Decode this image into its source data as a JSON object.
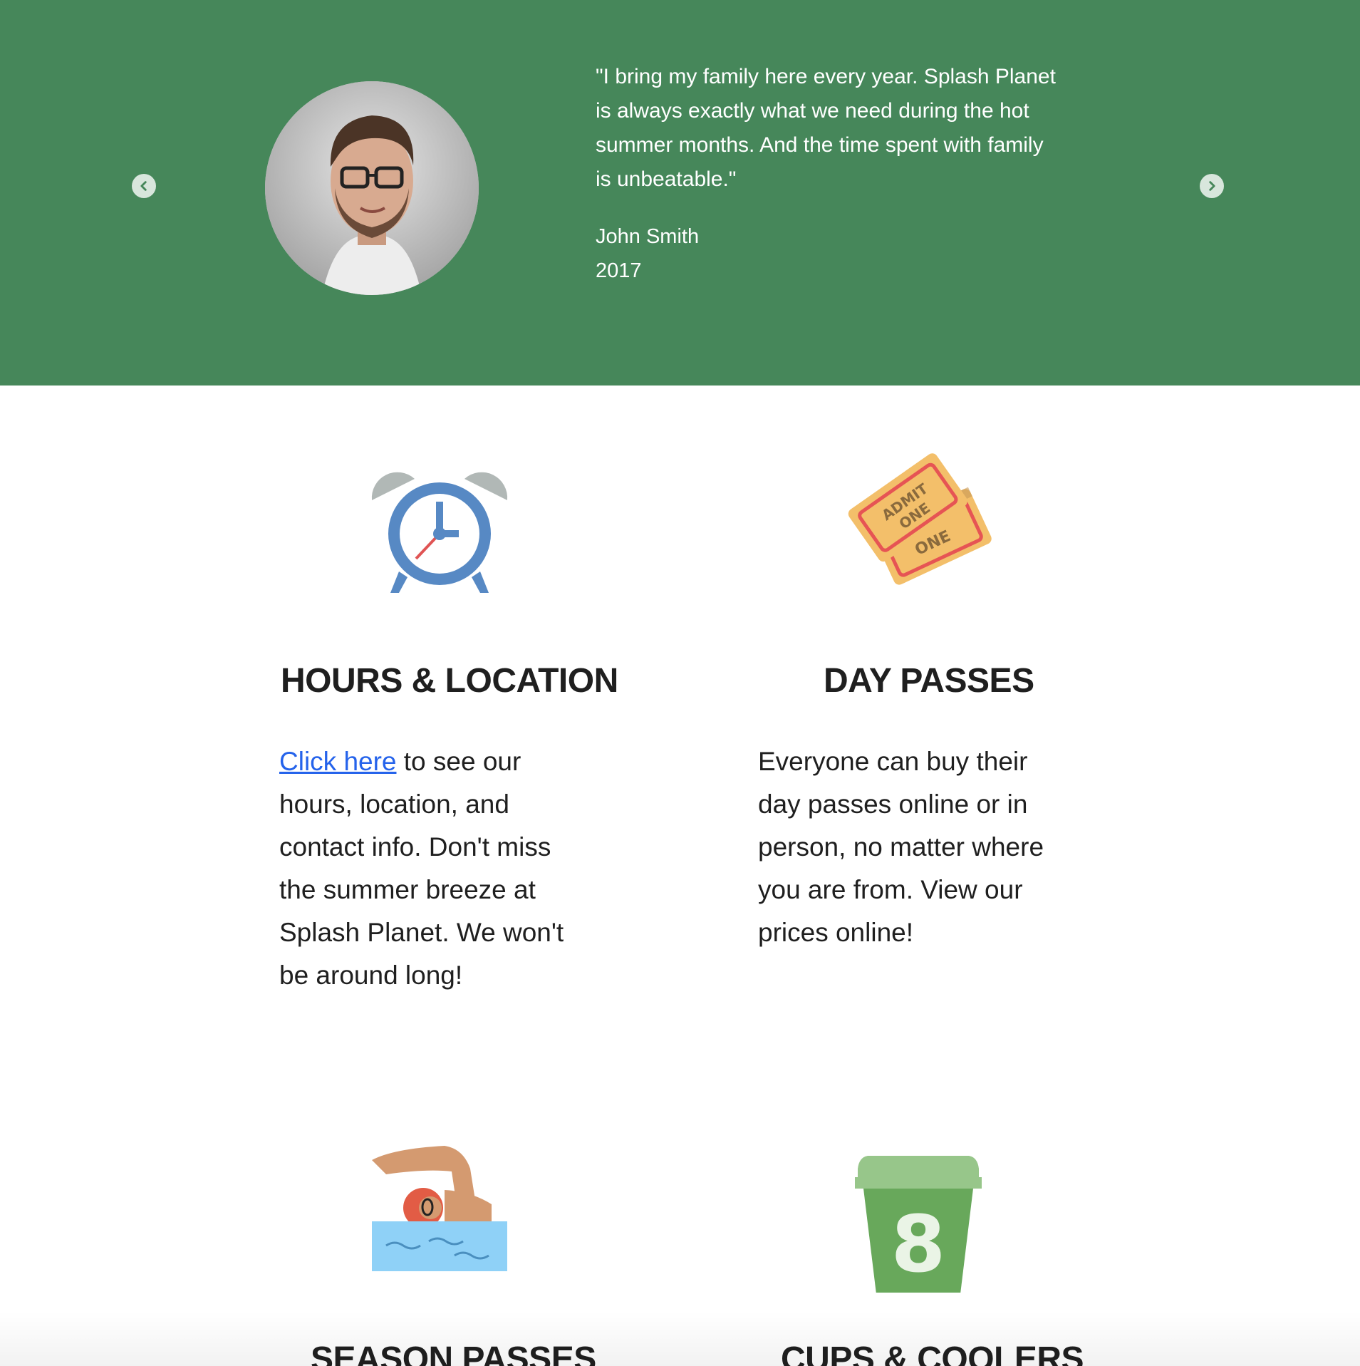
{
  "testimonial": {
    "quote": "\"I bring my family here every year. Splash Planet is always exactly what we need during the hot summer months. And the time spent with family is unbeatable.\"",
    "author": "John Smith",
    "year": "2017",
    "background_color": "#46875a"
  },
  "features": [
    {
      "icon": "alarm-clock-icon",
      "title": "HOURS & LOCATION",
      "link_text": "Click here",
      "body": " to see our hours, location, and contact info. Don't miss the summer breeze at Splash Planet. We won't be around long!"
    },
    {
      "icon": "tickets-icon",
      "title": "DAY PASSES",
      "body": "Everyone can buy their day passes online or in person, no matter where you are from. View our prices online!",
      "ticket_text_1": "ADMIT",
      "ticket_text_2": "ONE"
    },
    {
      "icon": "swimmer-icon",
      "title": "SEASON PASSES"
    },
    {
      "icon": "cup-icon",
      "title": "CUPS & COOLERS",
      "cup_number": "8"
    }
  ],
  "colors": {
    "link": "#2563eb",
    "text": "#1f1f1f"
  }
}
